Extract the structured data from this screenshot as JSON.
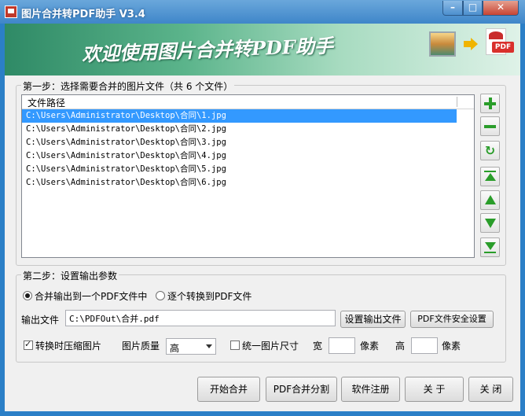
{
  "window": {
    "title": "图片合并转PDF助手 V3.4",
    "controls": {
      "min": "–",
      "max": "□",
      "close": "✕"
    }
  },
  "banner": {
    "text": "欢迎使用图片合并转PDF助手",
    "pdf_label": "PDF"
  },
  "step1": {
    "legend": "第一步：选择需要合并的图片文件（共 6 个文件）",
    "column": "文件路径",
    "files": [
      "C:\\Users\\Administrator\\Desktop\\合同\\1.jpg",
      "C:\\Users\\Administrator\\Desktop\\合同\\2.jpg",
      "C:\\Users\\Administrator\\Desktop\\合同\\3.jpg",
      "C:\\Users\\Administrator\\Desktop\\合同\\4.jpg",
      "C:\\Users\\Administrator\\Desktop\\合同\\5.jpg",
      "C:\\Users\\Administrator\\Desktop\\合同\\6.jpg"
    ],
    "selected_index": 0,
    "side_buttons": [
      "add-icon",
      "remove-icon",
      "refresh-icon",
      "move-top-icon",
      "move-up-icon",
      "move-down-icon",
      "move-bottom-icon"
    ]
  },
  "step2": {
    "legend": "第二步：设置输出参数",
    "radio_merge": "合并输出到一个PDF文件中",
    "radio_each": "逐个转换到PDF文件",
    "output_label": "输出文件",
    "output_value": "C:\\PDFOut\\合并.pdf",
    "btn_set_output": "设置输出文件",
    "btn_security": "PDF文件安全设置",
    "compress_label": "转换时压缩图片",
    "quality_label": "图片质量",
    "quality_value": "高",
    "unify_label": "统一图片尺寸",
    "width_label": "宽",
    "width_unit": "像素",
    "height_label": "高",
    "height_unit": "像素"
  },
  "footer": {
    "start": "开始合并",
    "split": "PDF合并分割",
    "register": "软件注册",
    "about": "关 于",
    "close": "关 闭"
  }
}
